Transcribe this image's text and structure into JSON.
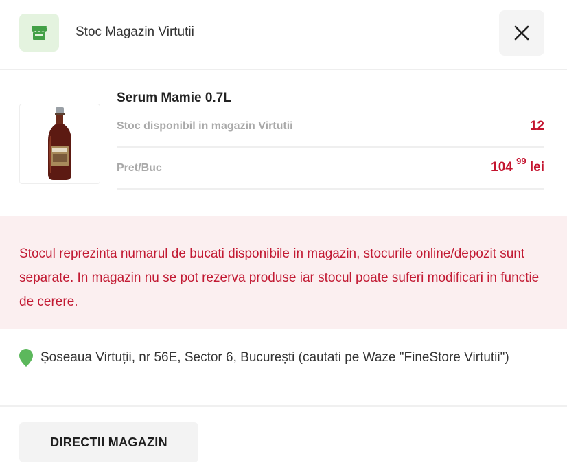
{
  "header": {
    "title": "Stoc Magazin Virtutii",
    "store_icon": "store-icon",
    "close_icon": "close-icon"
  },
  "product": {
    "name": "Serum Mamie 0.7L",
    "image_icon": "product-bottle-image",
    "stock_label": "Stoc disponibil in magazin Virtutii",
    "stock_value": "12",
    "price_label": "Pret/Buc",
    "price_main": "104",
    "price_cents": "99",
    "price_currency": "lei"
  },
  "notice": {
    "text": "Stocul reprezinta numarul de bucati disponibile in magazin, stocurile online/depozit sunt separate. In magazin nu se pot rezerva produse iar stocul poate suferi modificari in functie de cerere."
  },
  "address": {
    "icon": "location-pin-icon",
    "text": "Șoseaua Virtuții, nr 56E, Sector 6, București (cautati pe Waze \"FineStore Virtutii\")"
  },
  "actions": {
    "directions_label": "DIRECTII MAGAZIN"
  },
  "colors": {
    "accent_red": "#c4142f",
    "store_green": "#4caf50",
    "pin_green": "#5cb85c",
    "notice_bg": "#fbeff0"
  }
}
